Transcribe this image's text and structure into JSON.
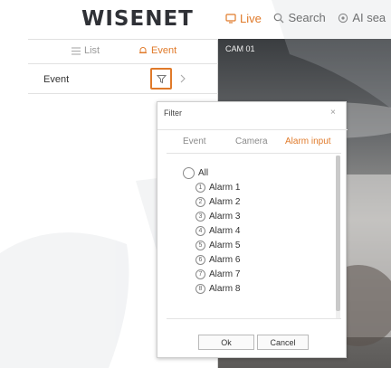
{
  "app": {
    "logo": "WISENET",
    "nav": [
      {
        "label": "Live",
        "active": true
      },
      {
        "label": "Search",
        "active": false
      },
      {
        "label": "AI sea",
        "active": false
      }
    ]
  },
  "left_panel": {
    "tabs": [
      {
        "label": "List",
        "active": false
      },
      {
        "label": "Event",
        "active": true
      }
    ],
    "event_row_label": "Event"
  },
  "camera": {
    "label": "CAM 01"
  },
  "filter_dialog": {
    "title": "Filter",
    "close_symbol": "×",
    "tabs": [
      {
        "label": "Event",
        "active": false
      },
      {
        "label": "Camera",
        "active": false
      },
      {
        "label": "Alarm input",
        "active": true
      }
    ],
    "options": [
      {
        "label": "All"
      },
      {
        "num": "1",
        "label": "Alarm 1"
      },
      {
        "num": "2",
        "label": "Alarm 2"
      },
      {
        "num": "3",
        "label": "Alarm 3"
      },
      {
        "num": "4",
        "label": "Alarm 4"
      },
      {
        "num": "5",
        "label": "Alarm 5"
      },
      {
        "num": "6",
        "label": "Alarm 6"
      },
      {
        "num": "7",
        "label": "Alarm 7"
      },
      {
        "num": "8",
        "label": "Alarm 8"
      }
    ],
    "ok_label": "Ok",
    "cancel_label": "Cancel"
  },
  "colors": {
    "accent": "#e07a2a",
    "text": "#333333",
    "muted": "#9a9a9a"
  }
}
